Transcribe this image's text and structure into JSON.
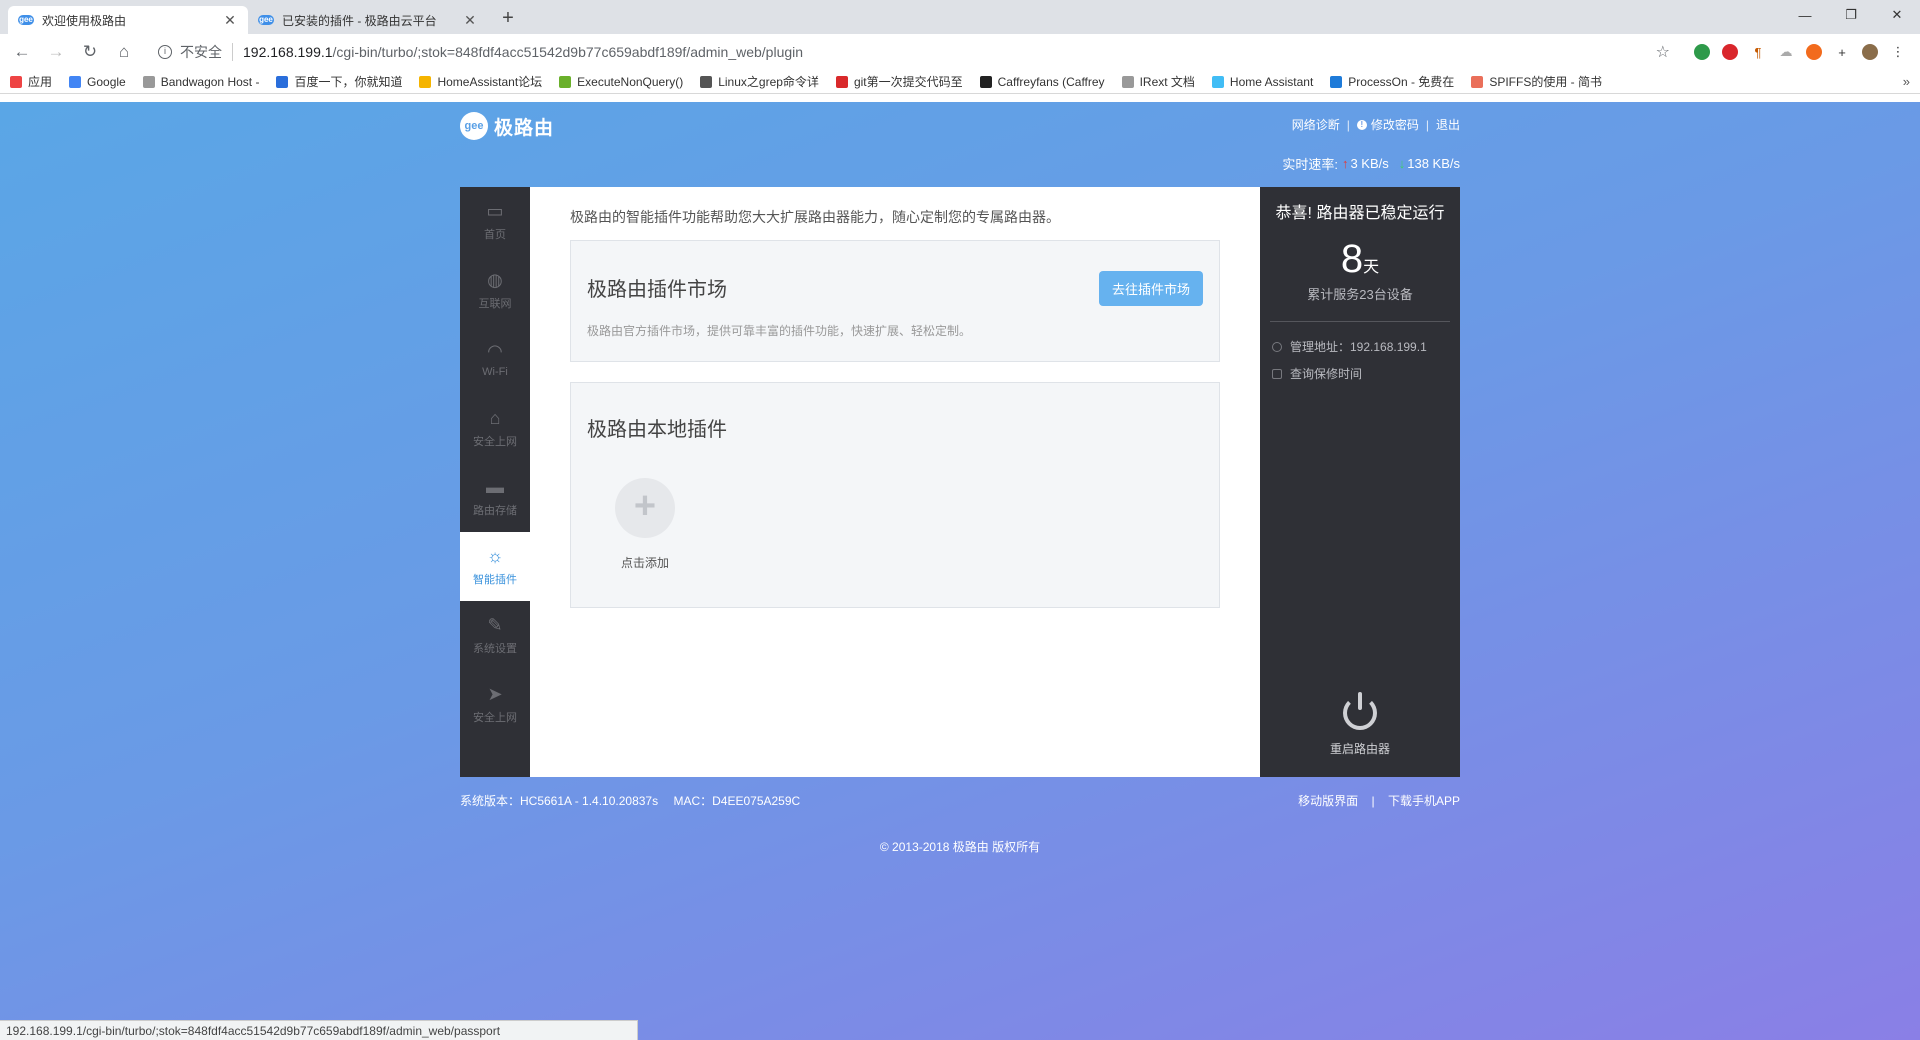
{
  "browser": {
    "tabs": [
      {
        "title": "欢迎使用极路由",
        "active": true
      },
      {
        "title": "已安装的插件 - 极路由云平台",
        "active": false
      }
    ],
    "favicon_text": "gee",
    "address": {
      "security_label": "不安全",
      "host": "192.168.199.1",
      "path": "/cgi-bin/turbo/;stok=848fdf4acc51542d9b77c659abdf189f/admin_web/plugin"
    },
    "bookmarks": [
      {
        "label": "应用",
        "icon": "apps-grid-icon",
        "color": "#e44"
      },
      {
        "label": "Google",
        "icon": "google-icon",
        "color": "#4285f4"
      },
      {
        "label": "Bandwagon Host -",
        "icon": "page-icon",
        "color": "#999"
      },
      {
        "label": "百度一下，你就知道",
        "icon": "baidu-icon",
        "color": "#2a6edb"
      },
      {
        "label": "HomeAssistant论坛",
        "icon": "forum-icon",
        "color": "#f5b400"
      },
      {
        "label": "ExecuteNonQuery()",
        "icon": "code-icon",
        "color": "#6ab02b"
      },
      {
        "label": "Linux之grep命令详",
        "icon": "tux-icon",
        "color": "#555"
      },
      {
        "label": "git第一次提交代码至",
        "icon": "csdn-icon",
        "color": "#d9292b"
      },
      {
        "label": "Caffreyfans (Caffrey",
        "icon": "github-icon",
        "color": "#222"
      },
      {
        "label": "IRext 文档",
        "icon": "page-icon",
        "color": "#999"
      },
      {
        "label": "Home Assistant",
        "icon": "home-assistant-icon",
        "color": "#41bdf5"
      },
      {
        "label": "ProcessOn - 免费在",
        "icon": "processon-icon",
        "color": "#1e7bd9"
      },
      {
        "label": "SPIFFS的使用 - 简书",
        "icon": "jianshu-icon",
        "color": "#ea6f5a"
      }
    ],
    "status_url": "192.168.199.1/cgi-bin/turbo/;stok=848fdf4acc51542d9b77c659abdf189f/admin_web/passport"
  },
  "router": {
    "brand": "极路由",
    "top_links": {
      "diagnose": "网络诊断",
      "change_password": "修改密码",
      "logout": "退出"
    },
    "speed": {
      "label": "实时速率:",
      "up": "3 KB/s",
      "down": "138 KB/s"
    },
    "sidebar": [
      {
        "label": "首页",
        "icon": "monitor-icon",
        "glyph": "▭",
        "active": false
      },
      {
        "label": "互联网",
        "icon": "globe-icon",
        "glyph": "◍",
        "active": false
      },
      {
        "label": "Wi-Fi",
        "icon": "wifi-icon",
        "glyph": "◠",
        "active": false
      },
      {
        "label": "安全上网",
        "icon": "lock-icon",
        "glyph": "⌂",
        "active": false
      },
      {
        "label": "路由存储",
        "icon": "folder-icon",
        "glyph": "▬",
        "active": false
      },
      {
        "label": "智能插件",
        "icon": "bulb-icon",
        "glyph": "☼",
        "active": true
      },
      {
        "label": "系统设置",
        "icon": "wrench-icon",
        "glyph": "✎",
        "active": false
      },
      {
        "label": "安全上网",
        "icon": "paper-plane-icon",
        "glyph": "➤",
        "active": false
      }
    ],
    "intro": "极路由的智能插件功能帮助您大大扩展路由器能力，随心定制您的专属路由器。",
    "market": {
      "title": "极路由插件市场",
      "desc": "极路由官方插件市场，提供可靠丰富的插件功能，快速扩展、轻松定制。",
      "button": "去往插件市场"
    },
    "local": {
      "title": "极路由本地插件",
      "add_label": "点击添加"
    },
    "status": {
      "title": "恭喜! 路由器已稳定运行",
      "days": "8",
      "days_unit": "天",
      "served": "累计服务23台设备",
      "admin_address": "管理地址：192.168.199.1",
      "warranty": "查询保修时间",
      "reboot": "重启路由器"
    },
    "footer": {
      "version": "系统版本：HC5661A - 1.4.10.20837s",
      "mac": "MAC：D4EE075A259C",
      "mobile": "移动版界面",
      "download": "下载手机APP",
      "copyright": "© 2013-2018 极路由 版权所有"
    }
  }
}
